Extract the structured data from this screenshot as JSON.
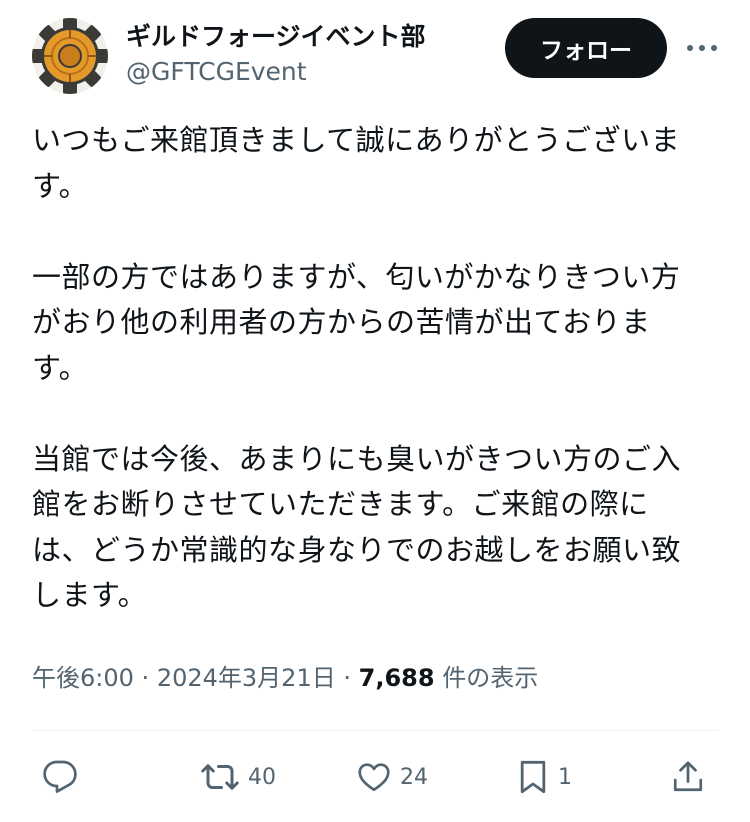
{
  "author": {
    "display_name": "ギルドフォージイベント部",
    "handle": "@GFTCGEvent",
    "avatar_icon": "gear-logo-icon",
    "avatar_colors": [
      "#e39a2b",
      "#3b3a36"
    ]
  },
  "follow_label": "フォロー",
  "tweet": {
    "paragraphs": [
      [
        "いつもご来館頂きまして誠にありがとうございま",
        "す。"
      ],
      [
        "一部の方ではありますが、匂いがかなりきつい方",
        "がおり他の利用者の方からの苦情が出ておりま",
        "す。"
      ],
      [
        "当館では今後、あまりにも臭いがきつい方のご入",
        "館をお断りさせていただきます。ご来館の際に",
        "は、どうか常識的な身なりでのお越しをお願い致",
        "します。"
      ]
    ]
  },
  "meta": {
    "time": "午後6:00",
    "separator": "·",
    "date": "2024年3月21日",
    "views_count": "7,688",
    "views_label": "件の表示"
  },
  "actions": {
    "reply_count": "",
    "retweet_count": "40",
    "like_count": "24",
    "bookmark_count": "1"
  },
  "colors": {
    "text": "#0f1419",
    "secondary": "#536471",
    "button_bg": "#0f1419",
    "divider": "#eff3f4"
  }
}
